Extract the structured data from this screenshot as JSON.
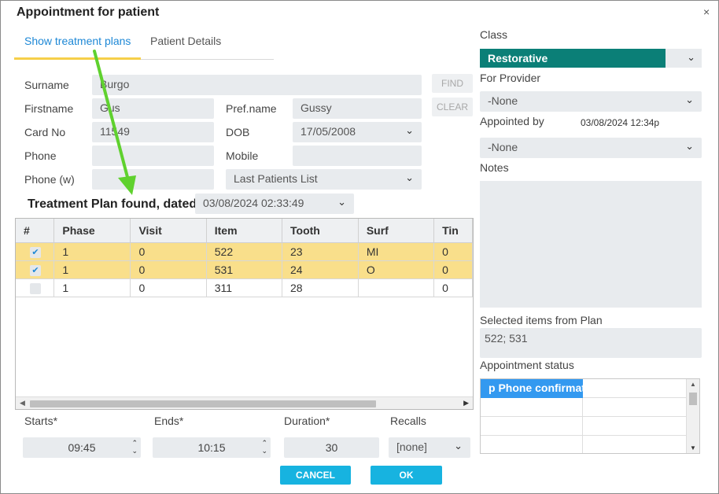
{
  "window": {
    "title": "Appointment for patient",
    "close_glyph": "×"
  },
  "tabs": [
    {
      "label": "Show treatment plans",
      "active": true
    },
    {
      "label": "Patient Details",
      "active": false
    }
  ],
  "patient": {
    "surname_label": "Surname",
    "surname_value": "Burgo",
    "firstname_label": "Firstname",
    "firstname_value": "Gus",
    "prefname_label": "Pref.name",
    "prefname_value": "Gussy",
    "cardno_label": "Card No",
    "cardno_value": "11549",
    "dob_label": "DOB",
    "dob_value": "17/05/2008",
    "phone_label": "Phone",
    "phone_value": "",
    "mobile_label": "Mobile",
    "mobile_value": "",
    "phonew_label": "Phone (w)",
    "phonew_value": "",
    "last_patients_label": "Last Patients List"
  },
  "buttons": {
    "find": "FIND",
    "clear": "CLEAR",
    "cancel": "CANCEL",
    "ok": "OK"
  },
  "treatment_plan": {
    "label": "Treatment Plan found, dated",
    "date": "03/08/2024 02:33:49",
    "columns": [
      "#",
      "Phase",
      "Visit",
      "Item",
      "Tooth",
      "Surf",
      "Tin"
    ],
    "rows": [
      {
        "checked": true,
        "selected": true,
        "phase": "1",
        "visit": "0",
        "item": "522",
        "tooth": "23",
        "surf": "MI",
        "tin": "0"
      },
      {
        "checked": true,
        "selected": true,
        "phase": "1",
        "visit": "0",
        "item": "531",
        "tooth": "24",
        "surf": "O",
        "tin": "0"
      },
      {
        "checked": false,
        "selected": false,
        "phase": "1",
        "visit": "0",
        "item": "311",
        "tooth": "28",
        "surf": "",
        "tin": "0"
      }
    ]
  },
  "times": {
    "starts_label": "Starts*",
    "starts_value": "09:45",
    "ends_label": "Ends*",
    "ends_value": "10:15",
    "duration_label": "Duration*",
    "duration_value": "30",
    "recalls_label": "Recalls",
    "recalls_value": "[none]"
  },
  "right": {
    "class_label": "Class",
    "class_value": "Restorative",
    "provider_label": "For Provider",
    "provider_value": "-None",
    "appointed_label": "Appointed by",
    "appointed_timestamp": "03/08/2024 12:34p",
    "appointed_value": "-None",
    "notes_label": "Notes",
    "selected_items_label": "Selected items from Plan",
    "selected_items_value": "522; 531",
    "status_label": "Appointment status",
    "status_value": "p Phone confirmati"
  },
  "colors": {
    "accent": "#1e88d6",
    "class_fill": "#0b7f77",
    "selected_row": "#f9df8b",
    "button": "#17b3e0",
    "status_head": "#3399f0",
    "annotation_arrow": "#5fd12e"
  },
  "icons": {
    "chevron": "chevron-down-icon",
    "check": "check-icon",
    "close": "close-icon"
  }
}
